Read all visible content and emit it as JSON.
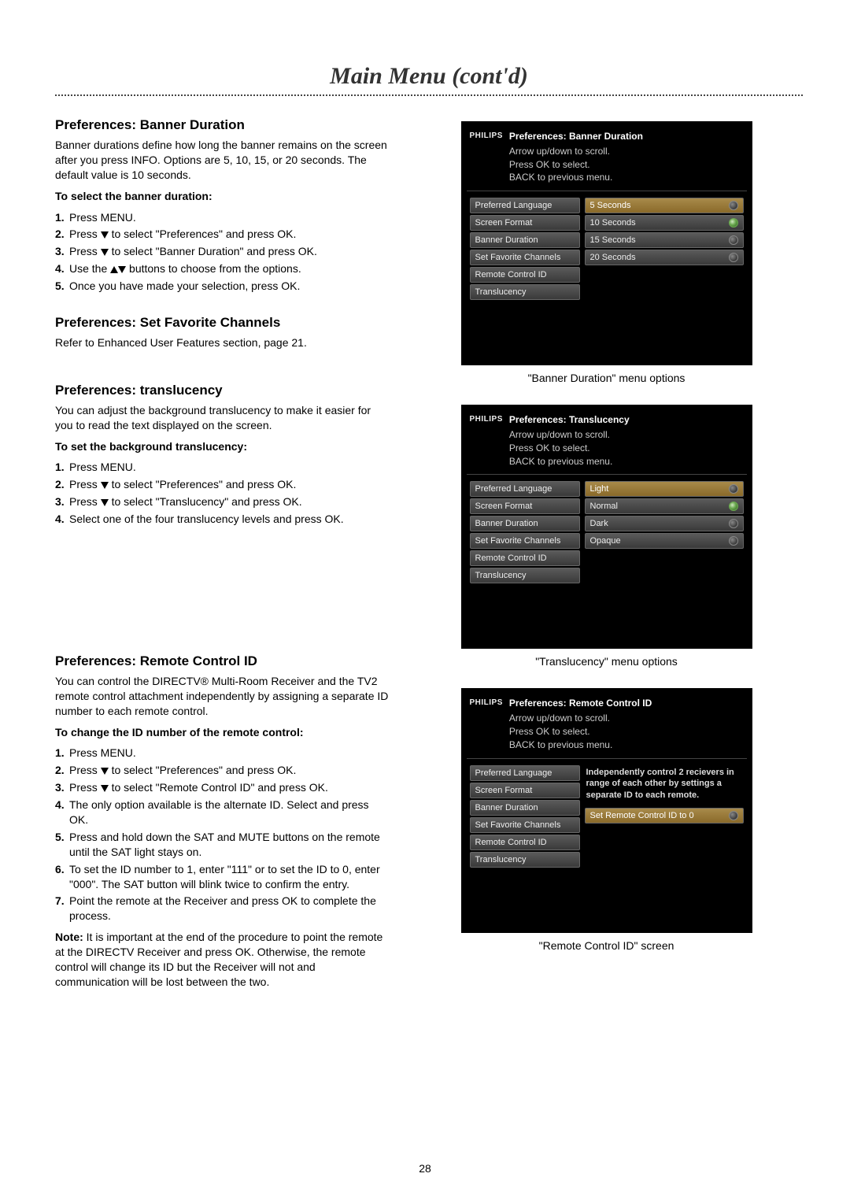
{
  "page_title": "Main Menu (cont'd)",
  "page_number": "28",
  "sections": {
    "banner": {
      "heading": "Preferences: Banner Duration",
      "intro": "Banner durations define how long the banner remains on the screen after you press INFO. Options are 5, 10, 15, or 20 seconds. The default value is 10 seconds.",
      "sub": "To select the banner duration:",
      "steps": [
        "Press MENU.",
        "Press ▼ to select \"Preferences\" and press OK.",
        "Press ▼ to select \"Banner Duration\" and press OK.",
        "Use the ▲▼ buttons to choose from the options.",
        "Once you have made your selection, press OK."
      ]
    },
    "fav": {
      "heading": "Preferences: Set Favorite Channels",
      "text": "Refer to Enhanced User Features section, page 21."
    },
    "trans": {
      "heading": "Preferences: translucency",
      "intro": "You can adjust the background translucency to make it easier for you to read the text displayed on the screen.",
      "sub": "To set the background translucency:",
      "steps": [
        "Press MENU.",
        "Press ▼ to select \"Preferences\" and press OK.",
        "Press ▼ to select \"Translucency\" and press OK.",
        "Select one of the four translucency levels and press OK."
      ]
    },
    "remote": {
      "heading": "Preferences: Remote Control ID",
      "intro": "You can control the DIRECTV® Multi-Room Receiver and the TV2 remote control attachment independently by assigning a separate ID number to each remote control.",
      "sub": "To change the ID number of the remote control:",
      "steps": [
        "Press MENU.",
        "Press ▼ to select \"Preferences\" and press OK.",
        "Press ▼ to select \"Remote Control ID\" and press OK.",
        "The only option available is the alternate ID. Select and press OK.",
        "Press and hold down the SAT and MUTE buttons on the remote until the SAT light stays on.",
        "To set the ID number to 1, enter \"111\" or to set the ID to 0, enter \"000\". The SAT button will blink twice to confirm the entry.",
        "Point the remote at the Receiver and press OK to complete the process."
      ],
      "note_label": "Note:",
      "note": " It is important at the end of the procedure to point the remote at the DIRECTV Receiver and press OK. Otherwise, the remote control will change its ID but the Receiver will not and communication will be lost between the two."
    }
  },
  "tv_common": {
    "logo": "PHILIPS",
    "hint1": "Arrow up/down to scroll.",
    "hint2": "Press OK to select.",
    "hint3": "BACK to previous menu.",
    "sidebar": [
      "Preferred Language",
      "Screen Format",
      "Banner Duration",
      "Set Favorite Channels",
      "Remote Control ID",
      "Translucency"
    ]
  },
  "tv_panels": {
    "banner": {
      "title": "Preferences: Banner Duration",
      "options": [
        "5  Seconds",
        "10 Seconds",
        "15 Seconds",
        "20 Seconds"
      ],
      "selected_index": 1,
      "caption": "\"Banner Duration\" menu options"
    },
    "trans": {
      "title": "Preferences: Translucency",
      "options": [
        "Light",
        "Normal",
        "Dark",
        "Opaque"
      ],
      "selected_index": 1,
      "caption": "\"Translucency\" menu options"
    },
    "remote": {
      "title": "Preferences: Remote Control ID",
      "desc": "Independently control 2 recievers in range of each other by settings a separate ID to each remote.",
      "button": "Set Remote Control ID to 0",
      "caption": "\"Remote Control ID\" screen"
    }
  }
}
